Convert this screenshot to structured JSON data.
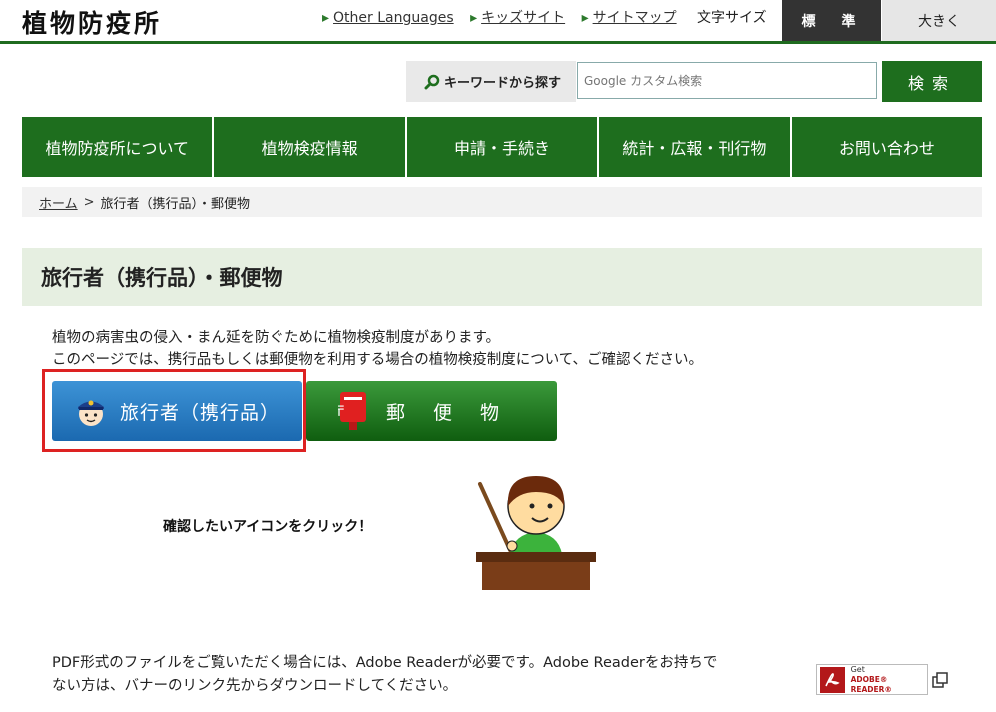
{
  "header": {
    "site_title": "植物防疫所",
    "links": [
      "Other Languages",
      "キッズサイト",
      "サイトマップ"
    ],
    "text_size_label": "文字サイズ",
    "size_standard": "標　準",
    "size_large": "大きく"
  },
  "search": {
    "label": "キーワードから探す",
    "placeholder": "Google カスタム検索",
    "button": "検索",
    "icon": "search-icon"
  },
  "nav": [
    "植物防疫所について",
    "植物検疫情報",
    "申請・手続き",
    "統計・広報・刊行物",
    "お問い合わせ"
  ],
  "breadcrumb": {
    "home": "ホーム",
    "separator": ">",
    "current": "旅行者（携行品）・郵便物"
  },
  "page": {
    "title": "旅行者（携行品）・郵便物",
    "intro_1": "植物の病害虫の侵入・まん延を防ぐために植物検疫制度があります。",
    "intro_2": "このページでは、携行品もしくは郵便物を利用する場合の植物検疫制度について、ご確認ください。",
    "traveler_button": "旅行者（携行品）",
    "mail_button": "郵便物",
    "click_prompt": "確認したいアイコンをクリック！",
    "pdf_note_1": "PDF形式のファイルをご覧いただく場合には、Adobe Readerが必要です。Adobe Readerをお持ちで",
    "pdf_note_2": "ない方は、バナーのリンク先からダウンロードしてください。",
    "adobe_get": "Get",
    "adobe_reader": "ADOBE® READER®"
  },
  "colors": {
    "green": "#1e6e1e",
    "blue_button": "#1b69b0",
    "highlight_red": "#dd2222"
  }
}
